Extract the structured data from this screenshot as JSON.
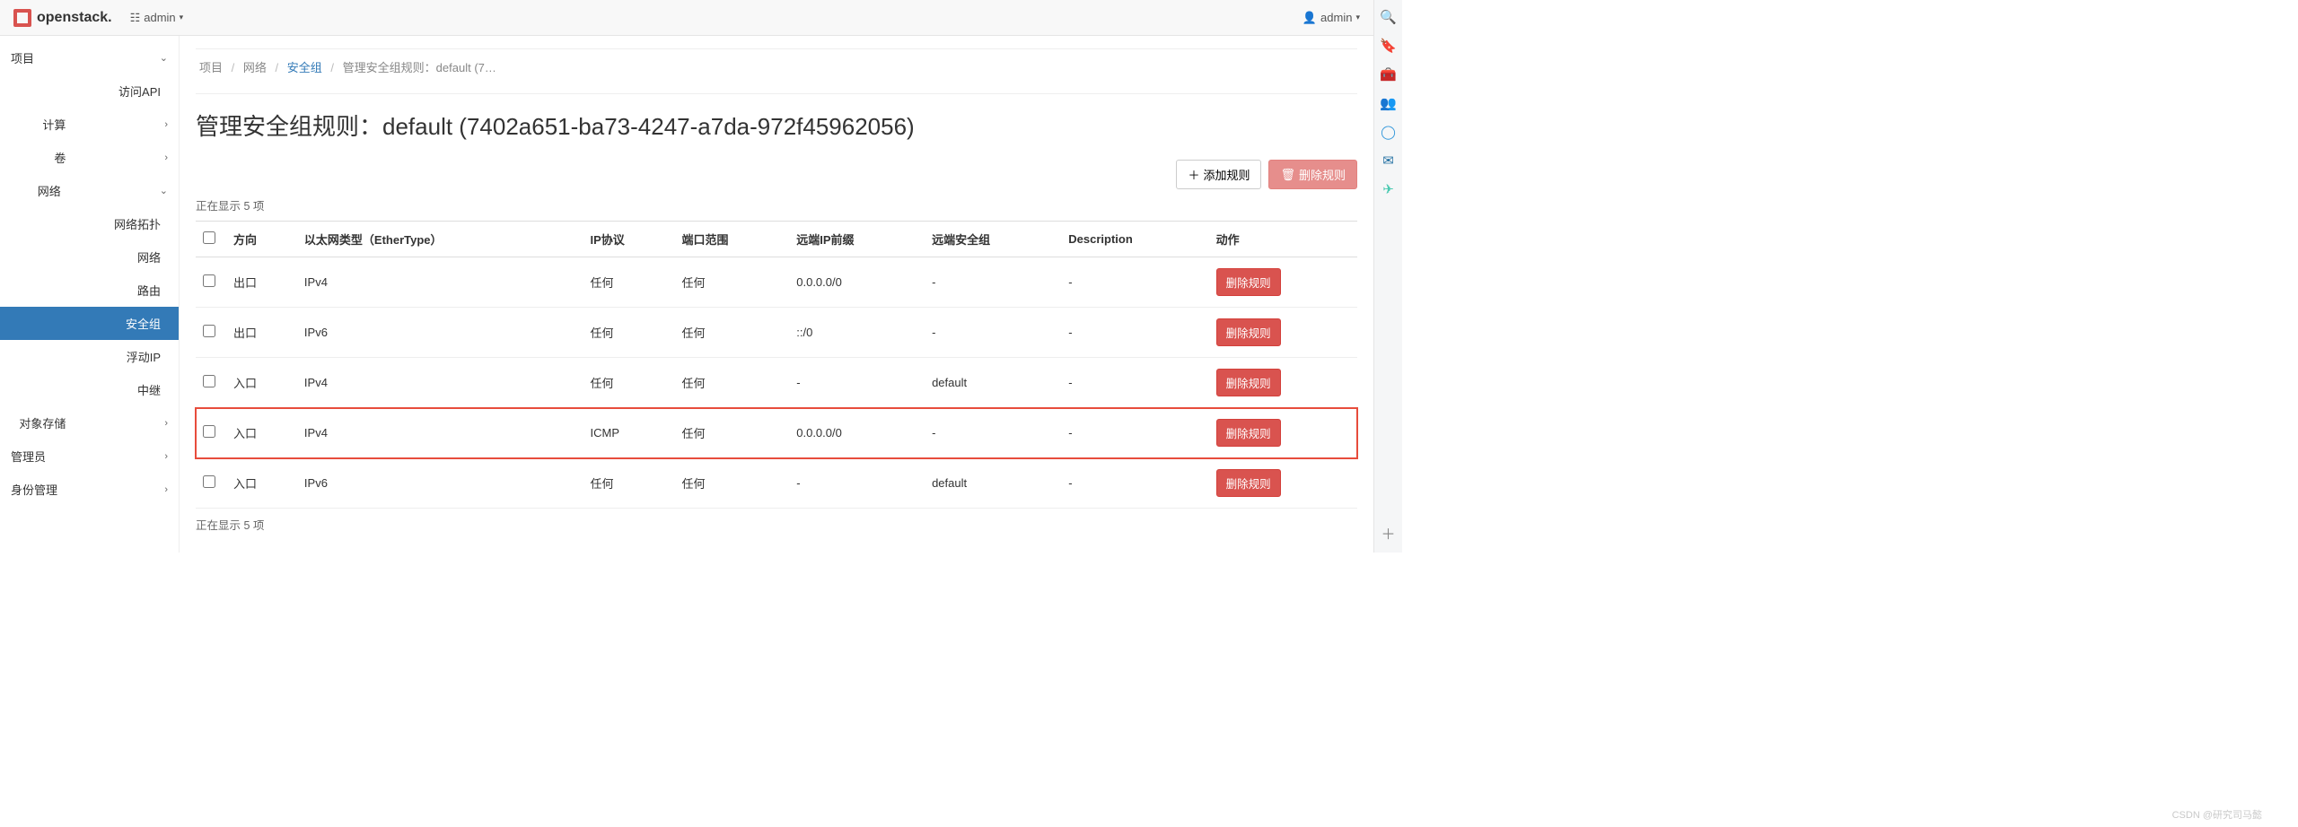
{
  "brand": "openstack.",
  "project_selector": {
    "icon": "layers-icon",
    "label": "admin"
  },
  "user_menu": {
    "label": "admin"
  },
  "sidebar": {
    "items": [
      {
        "label": "项目",
        "expanded": true,
        "children": [
          {
            "label": "访问API",
            "leaf": true
          },
          {
            "label": "计算",
            "leaf": false
          },
          {
            "label": "卷",
            "leaf": false
          },
          {
            "label": "网络",
            "expanded": true,
            "children": [
              {
                "label": "网络拓扑",
                "leaf": true
              },
              {
                "label": "网络",
                "leaf": true
              },
              {
                "label": "路由",
                "leaf": true
              },
              {
                "label": "安全组",
                "leaf": true,
                "active": true
              },
              {
                "label": "浮动IP",
                "leaf": true
              },
              {
                "label": "中继",
                "leaf": true
              }
            ]
          },
          {
            "label": "对象存储",
            "leaf": false
          }
        ]
      },
      {
        "label": "管理员",
        "leaf": false
      },
      {
        "label": "身份管理",
        "leaf": false
      }
    ]
  },
  "breadcrumb": {
    "items": [
      "项目",
      "网络",
      "安全组",
      "管理安全组规则：default (7…"
    ],
    "link_index": 2
  },
  "page_title": "管理安全组规则：default (7402a651-ba73-4247-a7da-972f45962056)",
  "toolbar": {
    "add_rule_label": "添加规则",
    "delete_rule_label": "删除规则"
  },
  "count_text_top": "正在显示 5 项",
  "count_text_bottom": "正在显示 5 项",
  "table": {
    "headers": [
      "方向",
      "以太网类型（EtherType）",
      "IP协议",
      "端口范围",
      "远端IP前缀",
      "远端安全组",
      "Description",
      "动作"
    ],
    "rows": [
      {
        "direction": "出口",
        "ethertype": "IPv4",
        "protocol": "任何",
        "port_range": "任何",
        "remote_ip": "0.0.0.0/0",
        "remote_sg": "-",
        "description": "-",
        "highlight": false
      },
      {
        "direction": "出口",
        "ethertype": "IPv6",
        "protocol": "任何",
        "port_range": "任何",
        "remote_ip": "::/0",
        "remote_sg": "-",
        "description": "-",
        "highlight": false
      },
      {
        "direction": "入口",
        "ethertype": "IPv4",
        "protocol": "任何",
        "port_range": "任何",
        "remote_ip": "-",
        "remote_sg": "default",
        "description": "-",
        "highlight": false
      },
      {
        "direction": "入口",
        "ethertype": "IPv4",
        "protocol": "ICMP",
        "port_range": "任何",
        "remote_ip": "0.0.0.0/0",
        "remote_sg": "-",
        "description": "-",
        "highlight": true
      },
      {
        "direction": "入口",
        "ethertype": "IPv6",
        "protocol": "任何",
        "port_range": "任何",
        "remote_ip": "-",
        "remote_sg": "default",
        "description": "-",
        "highlight": false
      }
    ],
    "row_action_label": "删除规则"
  },
  "watermark": "CSDN @研究司马懿"
}
